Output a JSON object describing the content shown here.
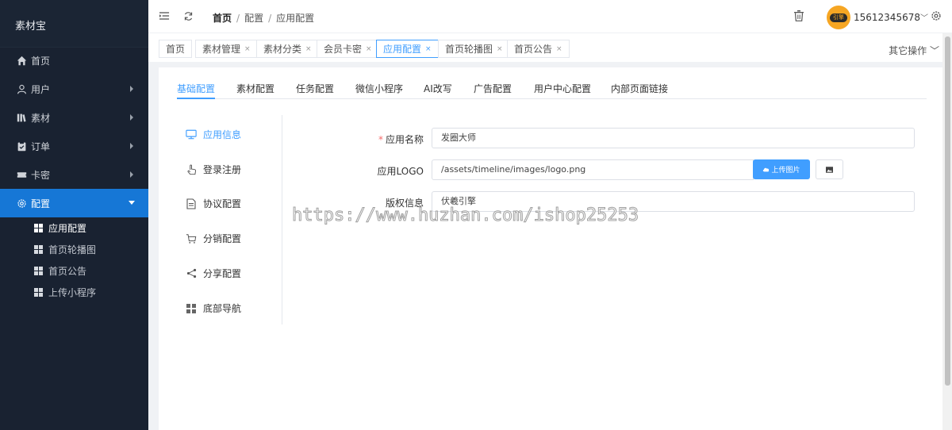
{
  "sidebar": {
    "brand": "素材宝",
    "items": [
      {
        "label": "首页",
        "icon": "home-icon",
        "has_children": false
      },
      {
        "label": "用户",
        "icon": "user-icon",
        "has_children": true
      },
      {
        "label": "素材",
        "icon": "library-icon",
        "has_children": true
      },
      {
        "label": "订单",
        "icon": "order-icon",
        "has_children": true
      },
      {
        "label": "卡密",
        "icon": "ticket-icon",
        "has_children": true
      },
      {
        "label": "配置",
        "icon": "gear-icon",
        "has_children": true,
        "expanded": true
      }
    ],
    "subitems": [
      {
        "label": "应用配置",
        "current": true
      },
      {
        "label": "首页轮播图"
      },
      {
        "label": "首页公告"
      },
      {
        "label": "上传小程序"
      }
    ]
  },
  "header": {
    "breadcrumb": {
      "home": "首页",
      "level1": "配置",
      "level2": "应用配置",
      "sep": "/"
    },
    "avatar_text": "引擎",
    "username": "15612345678",
    "chevron": "﹀"
  },
  "tabs": [
    {
      "label": "首页",
      "closable": false
    },
    {
      "label": "素材管理",
      "closable": true
    },
    {
      "label": "素材分类",
      "closable": true
    },
    {
      "label": "会员卡密",
      "closable": true
    },
    {
      "label": "应用配置",
      "closable": true,
      "active": true
    },
    {
      "label": "首页轮播图",
      "closable": true
    },
    {
      "label": "首页公告",
      "closable": true
    }
  ],
  "tab_close": "×",
  "other_ops": "其它操作 ﹀",
  "config_tabs": [
    "基础配置",
    "素材配置",
    "任务配置",
    "微信小程序",
    "AI改写",
    "广告配置",
    "用户中心配置",
    "内部页面链接"
  ],
  "side_menu": [
    {
      "label": "应用信息",
      "icon": "monitor-icon",
      "active": true
    },
    {
      "label": "登录注册",
      "icon": "hand-icon"
    },
    {
      "label": "协议配置",
      "icon": "document-icon"
    },
    {
      "label": "分销配置",
      "icon": "cart-icon"
    },
    {
      "label": "分享配置",
      "icon": "share-icon"
    },
    {
      "label": "底部导航",
      "icon": "grid-icon"
    }
  ],
  "form": {
    "app_name": {
      "label": "应用名称",
      "required_mark": "*",
      "value": "发圈大师"
    },
    "app_logo": {
      "label": "应用LOGO",
      "value": "/assets/timeline/images/logo.png",
      "upload_label": "上传图片"
    },
    "copyright": {
      "label": "版权信息",
      "value": "伏羲引擎"
    }
  },
  "watermark": "https://www.huzhan.com/ishop25253",
  "colors": {
    "sidebar_bg": "#192231",
    "accent": "#409eff",
    "active_nav": "#1677d6"
  }
}
